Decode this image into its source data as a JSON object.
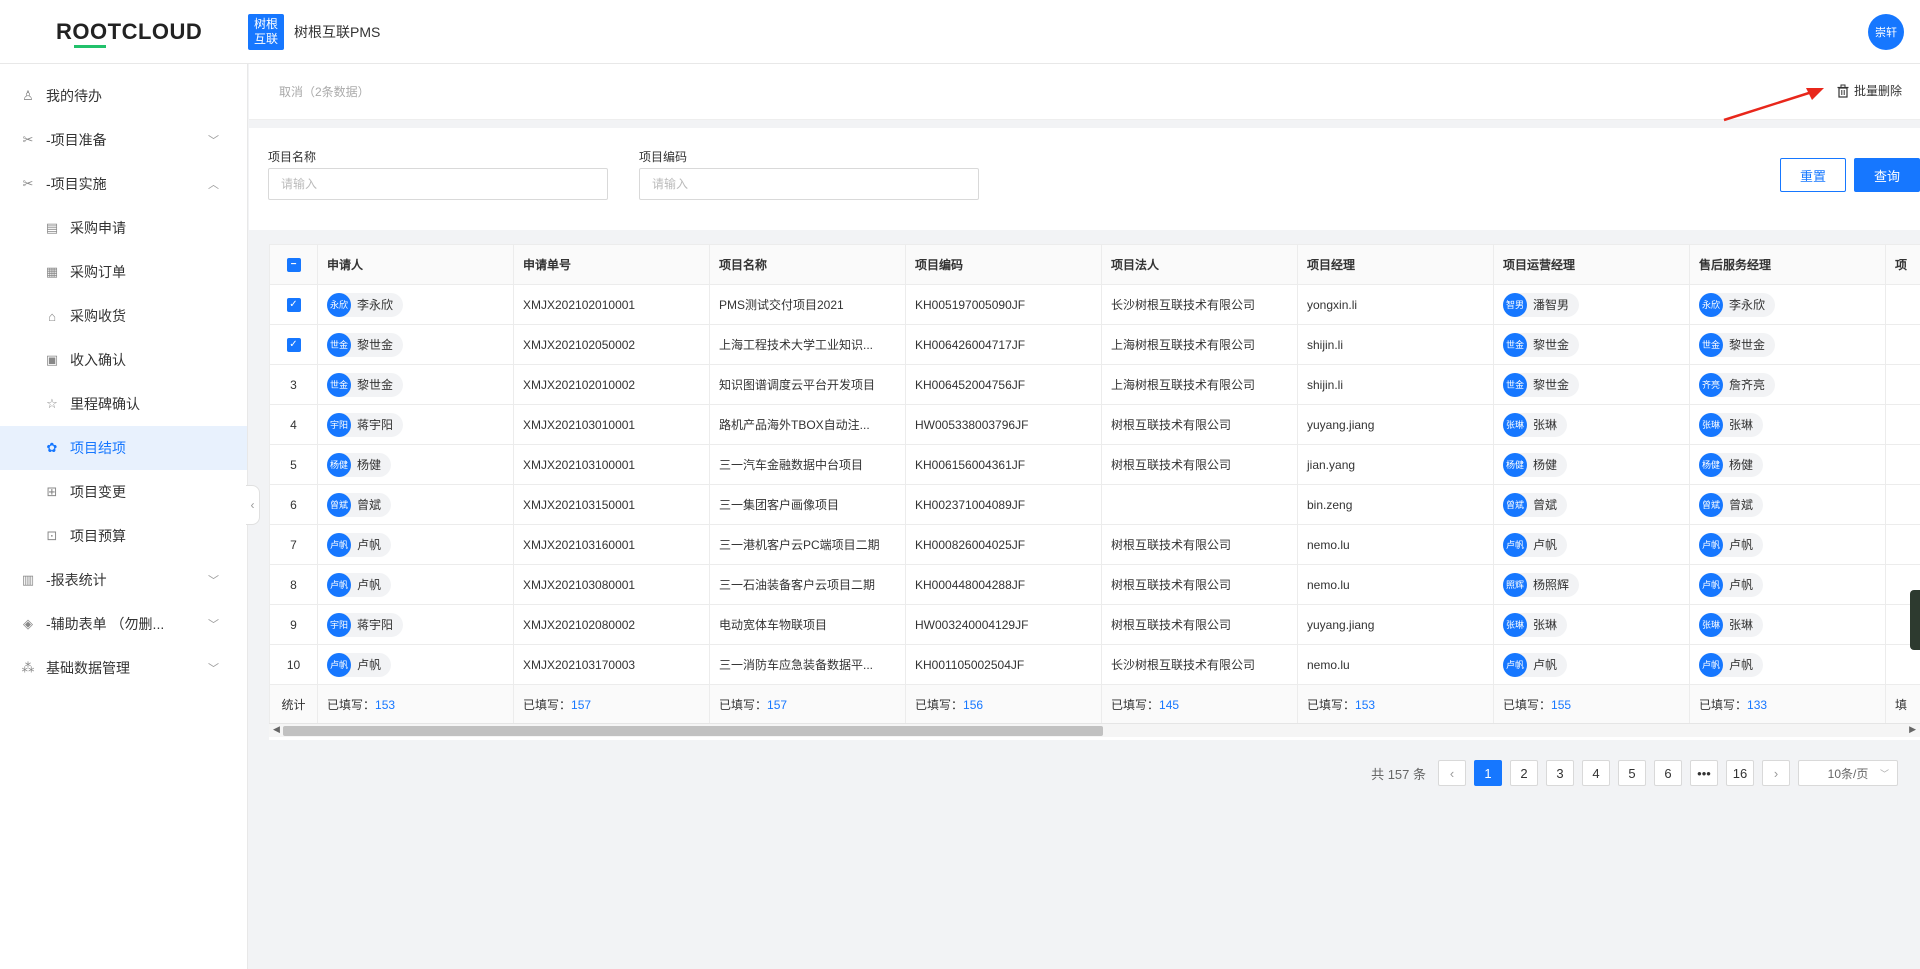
{
  "brand": {
    "logo_text_a": "R",
    "logo_text_b": "OO",
    "logo_text_c": "TCLOUD"
  },
  "app": {
    "badge_line1": "树根",
    "badge_line2": "互联",
    "name": "树根互联PMS"
  },
  "user": {
    "avatar_text": "崇轩"
  },
  "sidebar": {
    "items": [
      {
        "label": "我的待办",
        "icon": "user-icon"
      },
      {
        "label": "-项目准备",
        "icon": "tools-icon",
        "chevron": "﹀"
      },
      {
        "label": "-项目实施",
        "icon": "tools-icon",
        "chevron": "︿"
      },
      {
        "label": "采购申请",
        "icon": "doc-icon"
      },
      {
        "label": "采购订单",
        "icon": "order-icon"
      },
      {
        "label": "采购收货",
        "icon": "home-icon"
      },
      {
        "label": "收入确认",
        "icon": "receipt-icon"
      },
      {
        "label": "里程碑确认",
        "icon": "star-icon"
      },
      {
        "label": "项目结项",
        "icon": "award-icon"
      },
      {
        "label": "项目变更",
        "icon": "grid-icon"
      },
      {
        "label": "项目预算",
        "icon": "budget-icon"
      },
      {
        "label": "-报表统计",
        "icon": "report-icon",
        "chevron": "﹀"
      },
      {
        "label": "-辅助表单 （勿删...",
        "icon": "layers-icon",
        "chevron": "﹀"
      },
      {
        "label": "基础数据管理",
        "icon": "cluster-icon",
        "chevron": "﹀"
      }
    ],
    "collapse_glyph": "‹"
  },
  "actions": {
    "cancel": "取消（2条数据）",
    "batch_delete": "批量删除"
  },
  "filters": {
    "project_name_label": "项目名称",
    "project_name_placeholder": "请输入",
    "project_code_label": "项目编码",
    "project_code_placeholder": "请输入",
    "reset": "重置",
    "query": "查询"
  },
  "table": {
    "columns": [
      "申请人",
      "申请单号",
      "项目名称",
      "项目编码",
      "项目法人",
      "项目经理",
      "项目运营经理",
      "售后服务经理",
      "项"
    ],
    "rows": [
      {
        "idx": "✓",
        "applicant_av": "永欣",
        "applicant": "李永欣",
        "no": "XMJX202102010001",
        "name": "PMS测试交付项目2021",
        "code": "KH005197005090JF",
        "corp": "长沙树根互联技术有限公司",
        "pm": "yongxin.li",
        "ops_av": "智男",
        "ops": "潘智男",
        "svc_av": "永欣",
        "svc": "李永欣"
      },
      {
        "idx": "✓",
        "applicant_av": "世金",
        "applicant": "黎世金",
        "no": "XMJX202102050002",
        "name": "上海工程技术大学工业知识...",
        "code": "KH006426004717JF",
        "corp": "上海树根互联技术有限公司",
        "pm": "shijin.li",
        "ops_av": "世金",
        "ops": "黎世金",
        "svc_av": "世金",
        "svc": "黎世金"
      },
      {
        "idx": "3",
        "applicant_av": "世金",
        "applicant": "黎世金",
        "no": "XMJX202102010002",
        "name": "知识图谱调度云平台开发项目",
        "code": "KH006452004756JF",
        "corp": "上海树根互联技术有限公司",
        "pm": "shijin.li",
        "ops_av": "世金",
        "ops": "黎世金",
        "svc_av": "齐亮",
        "svc": "詹齐亮"
      },
      {
        "idx": "4",
        "applicant_av": "宇阳",
        "applicant": "蒋宇阳",
        "no": "XMJX202103010001",
        "name": "路机产品海外TBOX自动注...",
        "code": "HW005338003796JF",
        "corp": "树根互联技术有限公司",
        "pm": "yuyang.jiang",
        "ops_av": "张琳",
        "ops": "张琳",
        "svc_av": "张琳",
        "svc": "张琳"
      },
      {
        "idx": "5",
        "applicant_av": "杨健",
        "applicant": "杨健",
        "no": "XMJX202103100001",
        "name": "三一汽车金融数据中台项目",
        "code": "KH006156004361JF",
        "corp": "树根互联技术有限公司",
        "pm": "jian.yang",
        "ops_av": "杨健",
        "ops": "杨健",
        "svc_av": "杨健",
        "svc": "杨健"
      },
      {
        "idx": "6",
        "applicant_av": "曾斌",
        "applicant": "曾斌",
        "no": "XMJX202103150001",
        "name": "三一集团客户画像项目",
        "code": "KH002371004089JF",
        "corp": "",
        "pm": "bin.zeng",
        "ops_av": "曾斌",
        "ops": "曾斌",
        "svc_av": "曾斌",
        "svc": "曾斌"
      },
      {
        "idx": "7",
        "applicant_av": "卢帆",
        "applicant": "卢帆",
        "no": "XMJX202103160001",
        "name": "三一港机客户云PC端项目二期",
        "code": "KH000826004025JF",
        "corp": "树根互联技术有限公司",
        "pm": "nemo.lu",
        "ops_av": "卢帆",
        "ops": "卢帆",
        "svc_av": "卢帆",
        "svc": "卢帆"
      },
      {
        "idx": "8",
        "applicant_av": "卢帆",
        "applicant": "卢帆",
        "no": "XMJX202103080001",
        "name": "三一石油装备客户云项目二期",
        "code": "KH000448004288JF",
        "corp": "树根互联技术有限公司",
        "pm": "nemo.lu",
        "ops_av": "照辉",
        "ops": "杨照辉",
        "svc_av": "卢帆",
        "svc": "卢帆"
      },
      {
        "idx": "9",
        "applicant_av": "宇阳",
        "applicant": "蒋宇阳",
        "no": "XMJX202102080002",
        "name": "电动宽体车物联项目",
        "code": "HW003240004129JF",
        "corp": "树根互联技术有限公司",
        "pm": "yuyang.jiang",
        "ops_av": "张琳",
        "ops": "张琳",
        "svc_av": "张琳",
        "svc": "张琳"
      },
      {
        "idx": "10",
        "applicant_av": "卢帆",
        "applicant": "卢帆",
        "no": "XMJX202103170003",
        "name": "三一消防车应急装备数据平...",
        "code": "KH001105002504JF",
        "corp": "长沙树根互联技术有限公司",
        "pm": "nemo.lu",
        "ops_av": "卢帆",
        "ops": "卢帆",
        "svc_av": "卢帆",
        "svc": "卢帆"
      }
    ],
    "summary": {
      "label": "统计",
      "prefix": "已填写：",
      "values": [
        "153",
        "157",
        "157",
        "156",
        "145",
        "153",
        "155",
        "133"
      ],
      "last": "填"
    }
  },
  "pagination": {
    "total": "共 157 条",
    "prev": "‹",
    "pages": [
      "1",
      "2",
      "3",
      "4",
      "5",
      "6"
    ],
    "ellipsis": "•••",
    "last_page": "16",
    "next": "›",
    "page_size": "10条/页",
    "current": 1
  },
  "colors": {
    "primary": "#1677ff",
    "annotation_arrow": "#e8271b"
  }
}
